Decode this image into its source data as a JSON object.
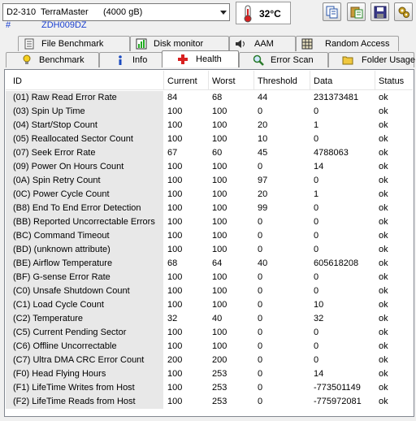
{
  "drive": {
    "selector_text": "D2-310  TerraMaster      (4000 gB)",
    "hash": "#",
    "serial": "ZDH009DZ",
    "temperature": "32°C"
  },
  "toolbar": {
    "buttons": [
      "copy-icon",
      "paste-icon",
      "save-icon",
      "settings-icon"
    ]
  },
  "tabs_top": [
    {
      "label": "File Benchmark",
      "icon": "file-benchmark-icon"
    },
    {
      "label": "Disk monitor",
      "icon": "chart-icon"
    },
    {
      "label": "AAM",
      "icon": "speaker-icon"
    },
    {
      "label": "Random Access",
      "icon": "grid-icon"
    }
  ],
  "tabs_bottom": [
    {
      "label": "Benchmark",
      "icon": "bulb-icon"
    },
    {
      "label": "Info",
      "icon": "info-icon"
    },
    {
      "label": "Health",
      "icon": "cross-icon",
      "active": true
    },
    {
      "label": "Error Scan",
      "icon": "magnifier-icon"
    },
    {
      "label": "Folder Usage",
      "icon": "folder-icon"
    }
  ],
  "table": {
    "columns": [
      "ID",
      "Current",
      "Worst",
      "Threshold",
      "Data",
      "Status"
    ],
    "rows": [
      [
        "(01) Raw Read Error Rate",
        "84",
        "68",
        "44",
        "231373481",
        "ok"
      ],
      [
        "(03) Spin Up Time",
        "100",
        "100",
        "0",
        "0",
        "ok"
      ],
      [
        "(04) Start/Stop Count",
        "100",
        "100",
        "20",
        "1",
        "ok"
      ],
      [
        "(05) Reallocated Sector Count",
        "100",
        "100",
        "10",
        "0",
        "ok"
      ],
      [
        "(07) Seek Error Rate",
        "67",
        "60",
        "45",
        "4788063",
        "ok"
      ],
      [
        "(09) Power On Hours Count",
        "100",
        "100",
        "0",
        "14",
        "ok"
      ],
      [
        "(0A) Spin Retry Count",
        "100",
        "100",
        "97",
        "0",
        "ok"
      ],
      [
        "(0C) Power Cycle Count",
        "100",
        "100",
        "20",
        "1",
        "ok"
      ],
      [
        "(B8) End To End Error Detection",
        "100",
        "100",
        "99",
        "0",
        "ok"
      ],
      [
        "(BB) Reported Uncorrectable Errors",
        "100",
        "100",
        "0",
        "0",
        "ok"
      ],
      [
        "(BC) Command Timeout",
        "100",
        "100",
        "0",
        "0",
        "ok"
      ],
      [
        "(BD) (unknown attribute)",
        "100",
        "100",
        "0",
        "0",
        "ok"
      ],
      [
        "(BE) Airflow Temperature",
        "68",
        "64",
        "40",
        "605618208",
        "ok"
      ],
      [
        "(BF) G-sense Error Rate",
        "100",
        "100",
        "0",
        "0",
        "ok"
      ],
      [
        "(C0) Unsafe Shutdown Count",
        "100",
        "100",
        "0",
        "0",
        "ok"
      ],
      [
        "(C1) Load Cycle Count",
        "100",
        "100",
        "0",
        "10",
        "ok"
      ],
      [
        "(C2) Temperature",
        "32",
        "40",
        "0",
        "32",
        "ok"
      ],
      [
        "(C5) Current Pending Sector",
        "100",
        "100",
        "0",
        "0",
        "ok"
      ],
      [
        "(C6) Offline Uncorrectable",
        "100",
        "100",
        "0",
        "0",
        "ok"
      ],
      [
        "(C7) Ultra DMA CRC Error Count",
        "200",
        "200",
        "0",
        "0",
        "ok"
      ],
      [
        "(F0) Head Flying Hours",
        "100",
        "253",
        "0",
        "14",
        "ok"
      ],
      [
        "(F1) LifeTime Writes from Host",
        "100",
        "253",
        "0",
        "-773501149",
        "ok"
      ],
      [
        "(F2) LifeTime Reads from Host",
        "100",
        "253",
        "0",
        "-775972081",
        "ok"
      ]
    ]
  },
  "colors": {
    "serial_text": "#1a3fd0",
    "thermo_red": "#d42020",
    "id_cell_bg": "#e8e8e8"
  }
}
